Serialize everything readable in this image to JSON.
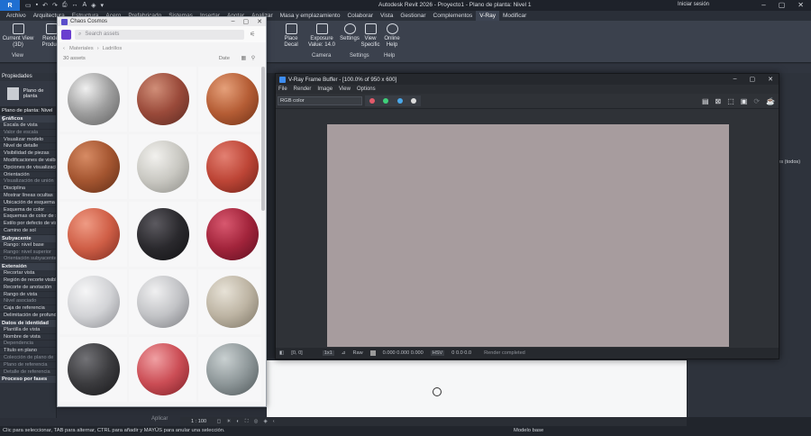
{
  "titlebar": {
    "app": "R",
    "title": "Autodesk Revit 2026 - Proyecto1 - Plano de planta: Nivel 1",
    "user": "Iniciar sesión"
  },
  "menu": [
    "Archivo",
    "Arquitectura",
    "Estructura",
    "Acero",
    "Prefabricado",
    "Sistemas",
    "Insertar",
    "Anotar",
    "Analizar",
    "Masa y emplazamiento",
    "Colaborar",
    "Vista",
    "Gestionar",
    "Complementos",
    "V-Ray",
    "Modificar"
  ],
  "menu_active": "V-Ray",
  "ribbon": {
    "buttons": [
      {
        "label": "Current View (3D)",
        "icon": "view-icon"
      },
      {
        "label": "Render Product",
        "icon": "render-icon"
      },
      {
        "label": "Place Decal",
        "icon": "decal-icon"
      },
      {
        "label": "Exposure Value: 14.0",
        "icon": "camera-icon"
      },
      {
        "label": "Settings",
        "icon": "gear-icon"
      },
      {
        "label": "View Specific",
        "icon": "view-specific-icon"
      },
      {
        "label": "Online Help",
        "icon": "help-icon"
      }
    ],
    "groups": [
      "View",
      "Camera",
      "Settings",
      "Help"
    ]
  },
  "properties": {
    "title": "Propiedades",
    "type_name": "Plano de planta",
    "selector": "Plano de planta: Nivel 1",
    "rows": [
      {
        "t": "Gráficos",
        "cat": true
      },
      {
        "t": "Escala de vista"
      },
      {
        "t": "Valor de escala",
        "dim": true
      },
      {
        "t": "Visualizar modelo"
      },
      {
        "t": "Nivel de detalle"
      },
      {
        "t": "Visibilidad de piezas"
      },
      {
        "t": "Modificaciones de visibilidad"
      },
      {
        "t": "Opciones de visualización"
      },
      {
        "t": "Orientación"
      },
      {
        "t": "Visualización de unión",
        "dim": true
      },
      {
        "t": "Disciplina"
      },
      {
        "t": "Mostrar líneas ocultas"
      },
      {
        "t": "Ubicación de esquema"
      },
      {
        "t": "Esquema de color"
      },
      {
        "t": "Esquemas de color de sistema"
      },
      {
        "t": "Estilo por defecto de vista"
      },
      {
        "t": "Camino de sol"
      },
      {
        "t": "Subyacente",
        "cat": true
      },
      {
        "t": "Rango: nivel base"
      },
      {
        "t": "Rango: nivel superior",
        "dim": true
      },
      {
        "t": "Orientación subyacente",
        "dim": true
      },
      {
        "t": "Extensión",
        "cat": true
      },
      {
        "t": "Recortar vista"
      },
      {
        "t": "Región de recorte visible"
      },
      {
        "t": "Recorte de anotación"
      },
      {
        "t": "Rango de vista"
      },
      {
        "t": "Nivel asociado",
        "dim": true
      },
      {
        "t": "Caja de referencia"
      },
      {
        "t": "Delimitación de profundidad"
      },
      {
        "t": "Datos de identidad",
        "cat": true
      },
      {
        "t": "Plantilla de vista"
      },
      {
        "t": "Nombre de vista"
      },
      {
        "t": "Dependencia",
        "dim": true
      },
      {
        "t": "Título en plano"
      },
      {
        "t": "Colección de plano de",
        "dim": true
      },
      {
        "t": "Plano de referencia",
        "dim": true
      },
      {
        "t": "Detalle de referencia",
        "dim": true
      },
      {
        "t": "Proceso por fases",
        "cat": true
      }
    ]
  },
  "cosmos": {
    "title": "Chaos Cosmos",
    "search_placeholder": "Search assets",
    "breadcrumb": [
      "Materiales",
      "Ladrillos"
    ],
    "count": "30 assets",
    "sort": "Date",
    "apply": "Aplicar",
    "materials": [
      {
        "c1": "#f0f0f0",
        "c2": "#9d9d9d",
        "c3": "#5e5e5e"
      },
      {
        "c1": "#d08e78",
        "c2": "#9a4a3a",
        "c3": "#5a2a22"
      },
      {
        "c1": "#e5a07a",
        "c2": "#b55d35",
        "c3": "#6e3016"
      },
      {
        "c1": "#d78b64",
        "c2": "#a45530",
        "c3": "#5f2d17"
      },
      {
        "c1": "#f2f1ee",
        "c2": "#c9c8c2",
        "c3": "#8d8c87"
      },
      {
        "c1": "#e38072",
        "c2": "#bd4536",
        "c3": "#6e2118"
      },
      {
        "c1": "#ef9b84",
        "c2": "#cf5e46",
        "c3": "#7b2b1f"
      },
      {
        "c1": "#5c5a60",
        "c2": "#2a292d",
        "c3": "#101012"
      },
      {
        "c1": "#d8586f",
        "c2": "#a2243b",
        "c3": "#5c0e1f"
      },
      {
        "c1": "#f6f6f7",
        "c2": "#d2d3d6",
        "c3": "#8b8c91"
      },
      {
        "c1": "#f0f0f1",
        "c2": "#c2c3c6",
        "c3": "#7a7b80"
      },
      {
        "c1": "#e7e2d7",
        "c2": "#bdb4a3",
        "c3": "#7a7263"
      },
      {
        "c1": "#727276",
        "c2": "#3b3b3e",
        "c3": "#18181a"
      },
      {
        "c1": "#f0a0a3",
        "c2": "#cb4d55",
        "c3": "#7c1f26"
      },
      {
        "c1": "#c9d0d1",
        "c2": "#8e9799",
        "c3": "#4d5557"
      }
    ]
  },
  "vray": {
    "title": "V-Ray Frame Buffer - [100.0% of 950 x 600]",
    "menu": [
      "File",
      "Render",
      "Image",
      "View",
      "Options"
    ],
    "channel": "RGB color",
    "status": {
      "coords": "[0, 0]",
      "zoom": "1x1",
      "raw_label": "Raw",
      "raw": "0.000   0.000   0.000",
      "mode": "HSV",
      "hsv": "0     0.0     0.0",
      "msg": "Render completed"
    },
    "canvas_color": "#a79c9e"
  },
  "right_panel": {
    "text": "ades (todos)"
  },
  "viewcontrol": {
    "scale": "1 : 100",
    "model": "Modelo base"
  },
  "status_bar": "Clic para seleccionar, TAB para alternar, CTRL para añadir y MAYÚS para anular una selección."
}
